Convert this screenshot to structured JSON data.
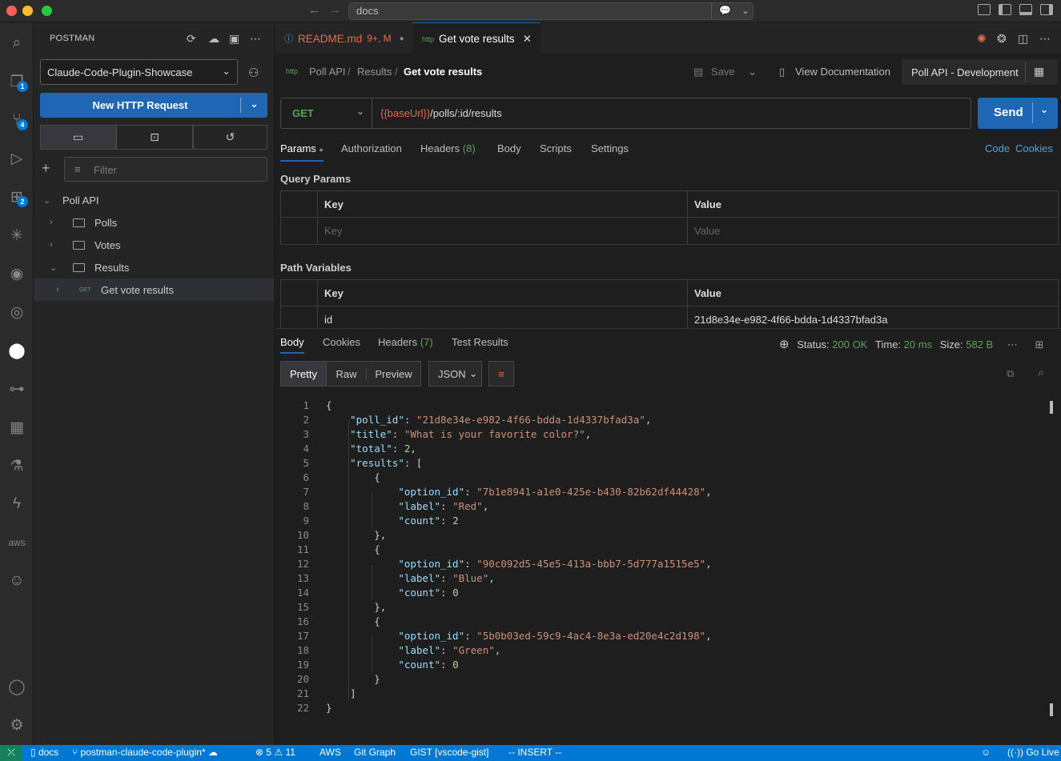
{
  "window": {
    "command_center": "docs"
  },
  "activity_bar": {
    "items": [
      {
        "icon": "search-icon"
      },
      {
        "icon": "explorer-icon",
        "badge": "1"
      },
      {
        "icon": "source-control-icon",
        "badge": "4"
      },
      {
        "icon": "run-debug-icon"
      },
      {
        "icon": "extensions-icon",
        "badge": "2"
      },
      {
        "icon": "claude-icon"
      },
      {
        "icon": "github-icon"
      },
      {
        "icon": "gitlens-icon"
      },
      {
        "icon": "postman-icon"
      },
      {
        "icon": "git-graph-icon"
      },
      {
        "icon": "docker-icon"
      },
      {
        "icon": "testing-icon"
      },
      {
        "icon": "thunder-client-icon"
      },
      {
        "icon": "aws-icon"
      },
      {
        "icon": "copilot-icon"
      }
    ],
    "bottom": [
      {
        "icon": "account-icon"
      },
      {
        "icon": "settings-gear-icon"
      }
    ]
  },
  "sidebar": {
    "title": "POSTMAN",
    "workspace": "Claude-Code-Plugin-Showcase",
    "new_request": "New HTTP Request",
    "filter_placeholder": "Filter",
    "tree": {
      "collection": "Poll API",
      "folders": [
        "Polls",
        "Votes",
        "Results"
      ],
      "request_method": "GET",
      "request_name": "Get vote results"
    }
  },
  "tabs": [
    {
      "label": "README.md",
      "status": "9+, M"
    },
    {
      "label": "Get vote results"
    }
  ],
  "breadcrumbs": {
    "items": [
      "Poll API",
      "Results"
    ],
    "current": "Get vote results",
    "save": "Save",
    "view_docs": "View Documentation",
    "environment": "Poll API - Development"
  },
  "request": {
    "method": "GET",
    "url_var": "{{baseUrl}}",
    "url_path": "/polls/:id/results",
    "send": "Send",
    "tabs": {
      "params": "Params",
      "authorization": "Authorization",
      "headers": "Headers",
      "headers_count": "(8)",
      "body": "Body",
      "scripts": "Scripts",
      "settings": "Settings",
      "code": "Code",
      "cookies": "Cookies"
    },
    "query_params": {
      "label": "Query Params",
      "key_header": "Key",
      "value_header": "Value",
      "key_placeholder": "Key",
      "value_placeholder": "Value"
    },
    "path_variables": {
      "label": "Path Variables",
      "key_header": "Key",
      "value_header": "Value",
      "key": "id",
      "value": "21d8e34e-e982-4f66-bdda-1d4337bfad3a"
    }
  },
  "response": {
    "tabs": {
      "body": "Body",
      "cookies": "Cookies",
      "headers": "Headers",
      "headers_count": "(7)",
      "test_results": "Test Results"
    },
    "status_label": "Status:",
    "status": "200 OK",
    "time_label": "Time:",
    "time": "20 ms",
    "size_label": "Size:",
    "size": "582 B",
    "format": {
      "pretty": "Pretty",
      "raw": "Raw",
      "preview": "Preview",
      "json": "JSON"
    },
    "lines": [
      "1",
      "2",
      "3",
      "4",
      "5",
      "6",
      "7",
      "8",
      "9",
      "10",
      "11",
      "12",
      "13",
      "14",
      "15",
      "16",
      "17",
      "18",
      "19",
      "20",
      "21",
      "22"
    ],
    "json": {
      "poll_id": "21d8e34e-e982-4f66-bdda-1d4337bfad3a",
      "title": "What is your favorite color?",
      "total": "2",
      "results": [
        {
          "option_id": "7b1e8941-a1e0-425e-b430-82b62df44428",
          "label": "Red",
          "count": "2"
        },
        {
          "option_id": "90c092d5-45e5-413a-bbb7-5d777a1515e5",
          "label": "Blue",
          "count": "0"
        },
        {
          "option_id": "5b0b03ed-59c9-4ac4-8e3a-ed20e4c2d198",
          "label": "Green",
          "count": "0"
        }
      ]
    }
  },
  "statusbar": {
    "folder": "docs",
    "branch": "postman-claude-code-plugin*",
    "errors": "5",
    "warnings": "11",
    "aws": "AWS",
    "git_graph": "Git Graph",
    "gist": "GIST [vscode-gist]",
    "mode": "-- INSERT --",
    "go_live": "Go Live"
  },
  "colors": {
    "accent": "#1f67b5",
    "status_bar": "#0078d4",
    "get_method": "#5ba35b",
    "url_variable": "#e8694a",
    "json_key": "#9cdcfe",
    "json_string": "#ce9178"
  }
}
